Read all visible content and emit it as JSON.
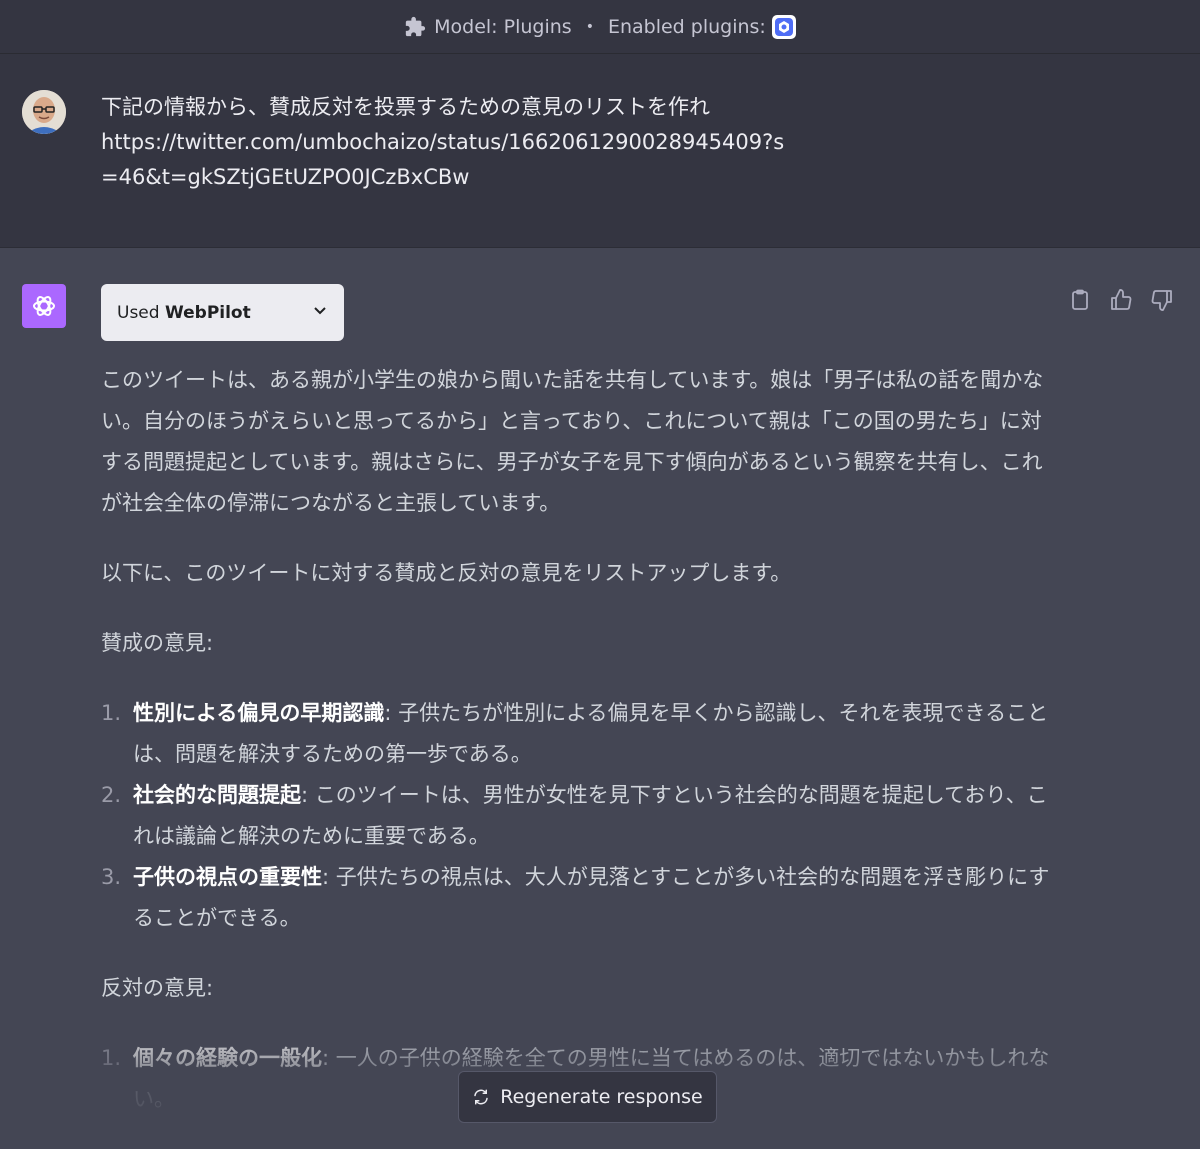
{
  "topbar": {
    "model_label": "Model: Plugins",
    "separator": "•",
    "enabled_label": "Enabled plugins:"
  },
  "user_message": {
    "text": "下記の情報から、賛成反対を投票するための意見のリストを作れ\nhttps://twitter.com/umbochaizo/status/1662061290028945409?s=46&t=gkSZtjGEtUZPO0JCzBxCBw"
  },
  "assistant": {
    "used_prefix": "Used",
    "plugin_name": "WebPilot",
    "paragraph1": "このツイートは、ある親が小学生の娘から聞いた話を共有しています。娘は「男子は私の話を聞かない。自分のほうがえらいと思ってるから」と言っており、これについて親は「この国の男たち」に対する問題提起としています。親はさらに、男子が女子を見下す傾向があるという観察を共有し、これが社会全体の停滞につながると主張しています。",
    "paragraph2": "以下に、このツイートに対する賛成と反対の意見をリストアップします。",
    "pro_heading": "賛成の意見:",
    "pro_items": [
      {
        "num": "1.",
        "title": "性別による偏見の早期認識",
        "text": ": 子供たちが性別による偏見を早くから認識し、それを表現できることは、問題を解決するための第一歩である。"
      },
      {
        "num": "2.",
        "title": "社会的な問題提起",
        "text": ": このツイートは、男性が女性を見下すという社会的な問題を提起しており、これは議論と解決のために重要である。"
      },
      {
        "num": "3.",
        "title": "子供の視点の重要性",
        "text": ": 子供たちの視点は、大人が見落とすことが多い社会的な問題を浮き彫りにすることができる。"
      }
    ],
    "con_heading": "反対の意見:",
    "con_items": [
      {
        "num": "1.",
        "title": "個々の経験の一般化",
        "text": ": 一人の子供の経験を全ての男性に当てはめるのは、適切ではないかもしれない。"
      }
    ]
  },
  "regenerate_label": "Regenerate response",
  "icons": {
    "topbar": "puzzle-icon",
    "plugin": "webpilot-icon",
    "bot": "openai-logo-icon",
    "actions": [
      "clipboard-icon",
      "thumbs-up-icon",
      "thumbs-down-icon"
    ],
    "dropdown": "chevron-down-icon",
    "regenerate": "refresh-icon"
  },
  "colors": {
    "page_bg": "#444654",
    "user_bg": "#343541",
    "bot_avatar": "#ab68ff",
    "plugin_box": "#ececf1"
  }
}
